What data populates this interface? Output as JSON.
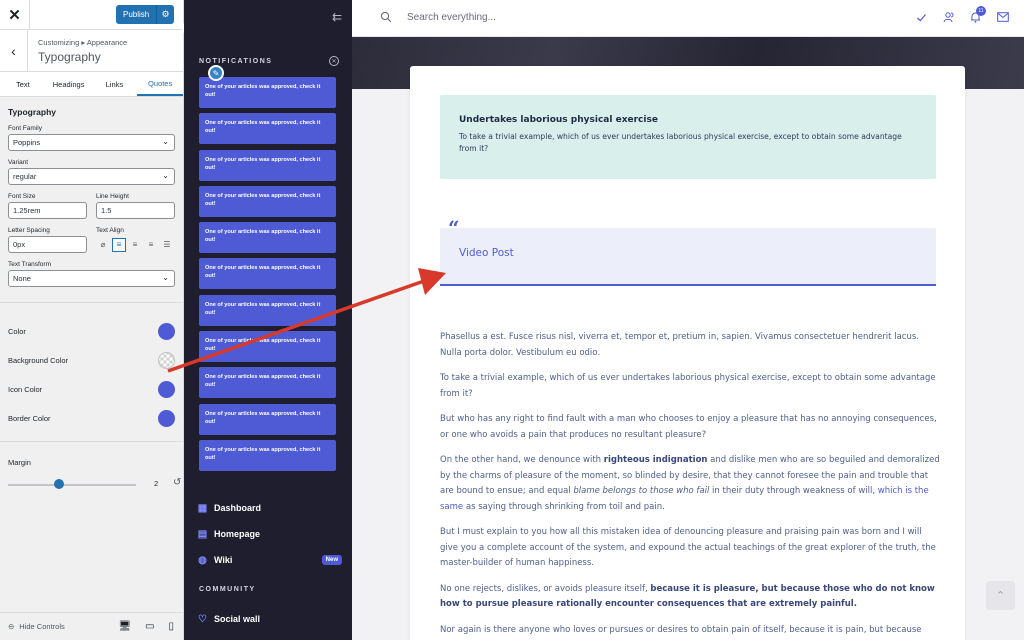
{
  "customizer": {
    "publish_label": "Publish",
    "breadcrumb": "Customizing ▸ Appearance",
    "section_title": "Typography",
    "tabs": [
      "Text",
      "Headings",
      "Links",
      "Quotes"
    ],
    "active_tab": "Quotes",
    "group_title": "Typography",
    "font_family": {
      "label": "Font Family",
      "value": "Poppins"
    },
    "variant": {
      "label": "Variant",
      "value": "regular"
    },
    "font_size": {
      "label": "Font Size",
      "value": "1.25rem"
    },
    "line_height": {
      "label": "Line Height",
      "value": "1.5"
    },
    "letter_spacing": {
      "label": "Letter Spacing",
      "value": "0px"
    },
    "text_align": {
      "label": "Text Align",
      "selected": "left"
    },
    "text_transform": {
      "label": "Text Transform",
      "value": "None"
    },
    "colors": [
      {
        "label": "Color",
        "value": "#4f5bd5"
      },
      {
        "label": "Background Color",
        "value": "transparent"
      },
      {
        "label": "Icon Color",
        "value": "#4f5bd5"
      },
      {
        "label": "Border Color",
        "value": "#4f5bd5"
      }
    ],
    "margin": {
      "label": "Margin",
      "value": "2",
      "fraction": 0.4
    },
    "hide_controls": "Hide Controls"
  },
  "sidebar": {
    "notifications_title": "NOTIFICATIONS",
    "notifications": [
      "One of your articles was approved, check it out!",
      "One of your articles was approved, check it out!",
      "One of your articles was approved, check it out!",
      "One of your articles was approved, check it out!",
      "One of your articles was approved, check it out!",
      "One of your articles was approved, check it out!",
      "One of your articles was approved, check it out!",
      "One of your articles was approved, check it out!",
      "One of your articles was approved, check it out!",
      "One of your articles was approved, check it out!",
      "One of your articles was approved, check it out!"
    ],
    "nav": [
      {
        "label": "Dashboard",
        "icon": "dashboard-icon"
      },
      {
        "label": "Homepage",
        "icon": "homepage-icon"
      },
      {
        "label": "Wiki",
        "icon": "wiki-icon",
        "badge": "New"
      }
    ],
    "community_title": "COMMUNITY",
    "community_items": [
      {
        "label": "Social wall",
        "icon": "heart-icon"
      }
    ]
  },
  "topbar": {
    "search_placeholder": "Search everything...",
    "notification_count": "11"
  },
  "article": {
    "callout_title": "Undertakes laborious physical exercise",
    "callout_text": "To take a trivial example, which of us ever undertakes laborious physical exercise, except to obtain some advantage from it?",
    "quote_title": "Video Post",
    "paragraphs": {
      "p1": "Phasellus a est. Fusce risus nisl, viverra et, tempor et, pretium in, sapien. Vivamus consectetuer hendrerit lacus. Nulla porta dolor. Vestibulum eu odio.",
      "p2": "To take a trivial example, which of us ever undertakes laborious physical exercise, except to obtain some advantage from it?",
      "p3": "But who has any right to find fault with a man who chooses to enjoy a pleasure that has no annoying consequences, or one who avoids a pain that produces no resultant pleasure?",
      "p4a": "On the other hand, we denounce with ",
      "p4b": "righteous indignation",
      "p4c": " and dislike men who are so beguiled and demoralized by the charms of pleasure of the moment, so blinded by desire, that they cannot foresee the pain and trouble that are bound to ensue; and equal ",
      "p4d": "blame belongs to those who fail",
      "p4e": " in their duty through weakness of will, ",
      "p4f": "which is the same",
      "p4g": " as saying through shrinking from toil and pain.",
      "p5": "But I must explain to you how all this mistaken idea of denouncing pleasure and praising pain was born and I will give you a complete account of the system, and expound the actual teachings of the great explorer of the truth, the master-builder of human happiness.",
      "p6a": "No one rejects, dislikes, or avoids pleasure itself, ",
      "p6b": "because it is pleasure, but because those who do not know how to pursue pleasure rationally encounter consequences that are extremely painful.",
      "p7": "Nor again is there anyone who loves or pursues or desires to obtain pain of itself, because it is pain, but because occasionally circumstances occur in which toil and pain can procure him some great"
    }
  },
  "colors": {
    "accent": "#4f5bd5",
    "sidebar_bg": "#1e1e2f",
    "annotation_arrow": "#d8392b"
  }
}
